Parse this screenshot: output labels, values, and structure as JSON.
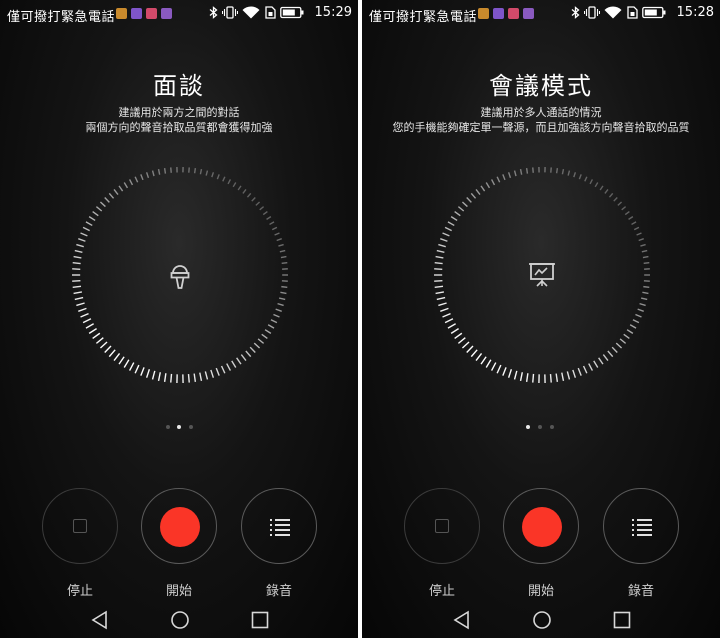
{
  "status_bar": {
    "carrier": "僅可撥打緊急電話"
  },
  "screens": [
    {
      "status_time": "15:29",
      "title": "面談",
      "subtitle_line1": "建議用於兩方之間的對話",
      "subtitle_line2": "兩個方向的聲音拾取品質都會獲得加強",
      "mode_icon": "microphone-icon",
      "active_page": 2
    },
    {
      "status_time": "15:28",
      "title": "會議模式",
      "subtitle_line1": "建議用於多人通話的情況",
      "subtitle_line2": "您的手機能夠確定單一聲源，而且加強該方向聲音拾取的品質",
      "mode_icon": "presentation-board-icon",
      "active_page": 1
    }
  ],
  "controls": {
    "stop_label": "停止",
    "start_label": "開始",
    "list_label": "錄音"
  },
  "colors": {
    "record": "#fa3527",
    "background": "#111111",
    "text": "#ffffff"
  },
  "notification_icons": [
    "orange-app-icon",
    "purple-app-icon",
    "pink-app-icon",
    "purple-gallery-icon"
  ],
  "system_icons": [
    "bluetooth-icon",
    "vibrate-icon",
    "wifi-icon",
    "sim-icon",
    "battery-icon"
  ],
  "nav_icons": [
    "back-icon",
    "home-icon",
    "recents-icon"
  ]
}
